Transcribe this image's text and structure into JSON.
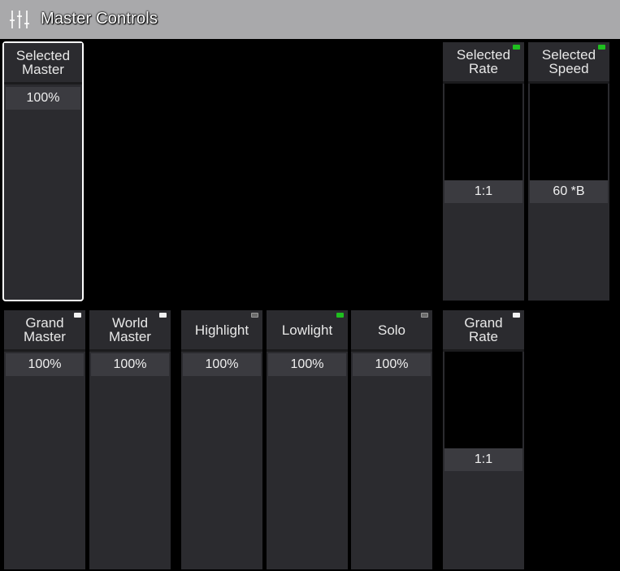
{
  "window": {
    "title": "Master Controls",
    "icon": "sliders-icon"
  },
  "faders": {
    "selected_master": {
      "label": "Selected\nMaster",
      "value": "100%"
    },
    "selected_rate": {
      "label": "Selected\nRate",
      "value": "1:1",
      "led": "green"
    },
    "selected_speed": {
      "label": "Selected\nSpeed",
      "value": "60 *B",
      "led": "green"
    },
    "grand_master": {
      "label": "Grand\nMaster",
      "value": "100%",
      "led": "white"
    },
    "world_master": {
      "label": "World\nMaster",
      "value": "100%",
      "led": "white"
    },
    "highlight": {
      "label": "Highlight",
      "value": "100%",
      "led": "gray"
    },
    "lowlight": {
      "label": "Lowlight",
      "value": "100%",
      "led": "green"
    },
    "solo": {
      "label": "Solo",
      "value": "100%",
      "led": "gray"
    },
    "grand_rate": {
      "label": "Grand\nRate",
      "value": "1:1",
      "led": "white"
    }
  },
  "colors": {
    "title_bar": "#a9a9ab",
    "panel": "#2b2b2f",
    "value_bg": "#3b3b40",
    "led_on": "#1fbf1f"
  }
}
